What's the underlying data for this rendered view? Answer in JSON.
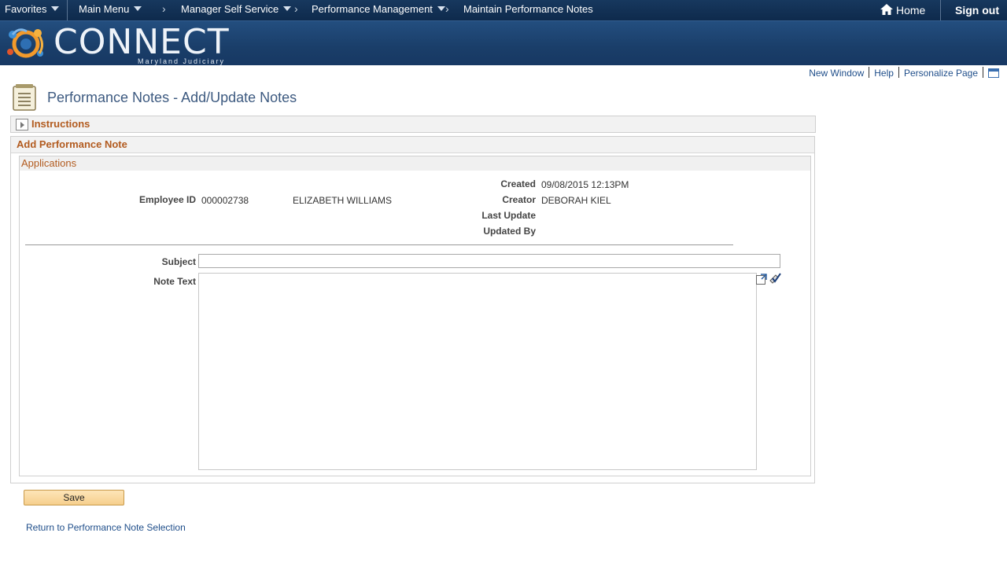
{
  "nav": {
    "favorites": "Favorites",
    "main_menu": "Main Menu",
    "breadcrumbs": [
      "Manager Self Service",
      "Performance Management",
      "Maintain Performance Notes"
    ],
    "home": "Home",
    "sign_out": "Sign out"
  },
  "banner": {
    "brand": "CONNECT",
    "subtitle": "Maryland Judiciary"
  },
  "utility_links": {
    "new_window": "New Window",
    "help": "Help",
    "personalize": "Personalize Page"
  },
  "page": {
    "title": "Performance Notes - Add/Update Notes"
  },
  "instructions": {
    "label": "Instructions"
  },
  "section": {
    "label": "Add Performance Note",
    "sub_label": "Applications"
  },
  "employee": {
    "id_label": "Employee ID",
    "id": "000002738",
    "name": "ELIZABETH WILLIAMS"
  },
  "meta": {
    "created_label": "Created",
    "created": "09/08/2015 12:13PM",
    "creator_label": "Creator",
    "creator": "DEBORAH KIEL",
    "last_update_label": "Last Update",
    "last_update": "",
    "updated_by_label": "Updated By",
    "updated_by": ""
  },
  "form": {
    "subject_label": "Subject",
    "subject_value": "",
    "note_text_label": "Note Text",
    "note_text_value": ""
  },
  "actions": {
    "save": "Save",
    "return_link": "Return to Performance Note Selection"
  },
  "colors": {
    "nav_bg": "#0e2a4c",
    "banner_bg": "#1a3e69",
    "section_label": "#b25b1f",
    "link": "#1f4e8a",
    "save_button": "#f6cf8d"
  }
}
